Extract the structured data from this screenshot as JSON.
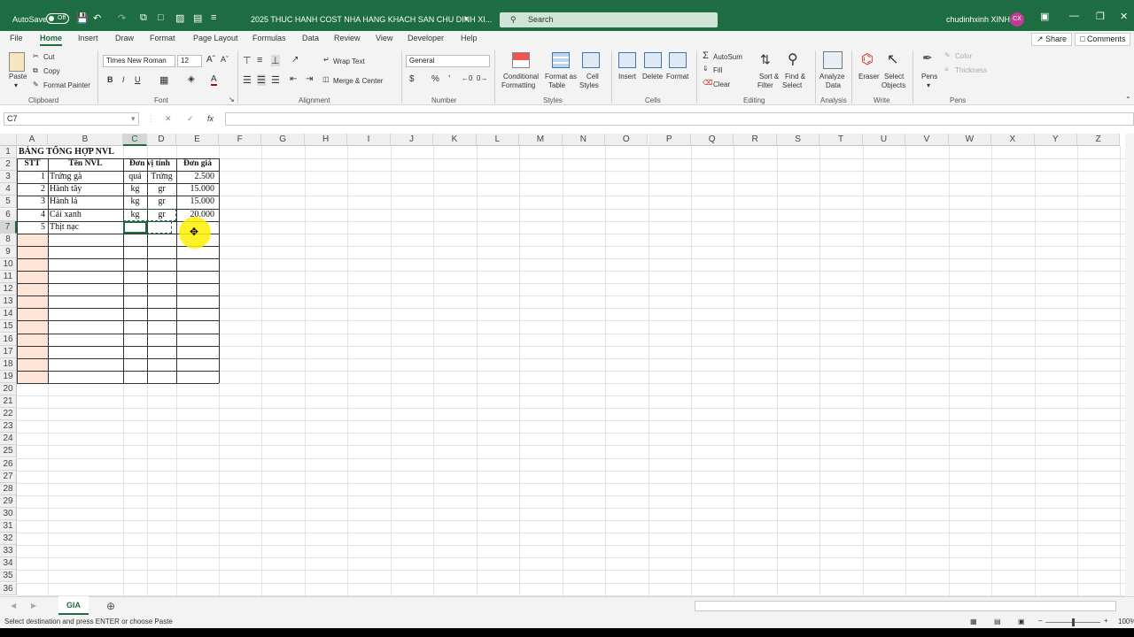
{
  "titlebar": {
    "autosave_label": "AutoSave",
    "autosave_state": "Off",
    "filename": "2025 THUC HANH COST NHA HANG KHACH SAN CHU DINH XI...",
    "search_placeholder": "Search",
    "user_name": "chudinhxinh XINH",
    "user_initials": "CX"
  },
  "menu": {
    "tabs": [
      "File",
      "Home",
      "Insert",
      "Draw",
      "Format",
      "Page Layout",
      "Formulas",
      "Data",
      "Review",
      "View",
      "Developer",
      "Help"
    ],
    "share_label": "Share",
    "comments_label": "Comments"
  },
  "ribbon": {
    "paste": "Paste",
    "cut": "Cut",
    "copy": "Copy",
    "format_painter": "Format Painter",
    "font_name": "Times New Roman",
    "font_size": "12",
    "wrap_text": "Wrap Text",
    "merge_center": "Merge & Center",
    "number_format": "General",
    "conditional_formatting_1": "Conditional",
    "conditional_formatting_2": "Formatting",
    "format_as_table_1": "Format as",
    "format_as_table_2": "Table",
    "cell_styles_1": "Cell",
    "cell_styles_2": "Styles",
    "insert": "Insert",
    "delete": "Delete",
    "format": "Format",
    "autosum": "AutoSum",
    "fill": "Fill",
    "clear": "Clear",
    "sort_filter_1": "Sort &",
    "sort_filter_2": "Filter",
    "find_select_1": "Find &",
    "find_select_2": "Select",
    "analyze_data_1": "Analyze",
    "analyze_data_2": "Data",
    "eraser": "Eraser",
    "select_objects_1": "Select",
    "select_objects_2": "Objects",
    "pens": "Pens",
    "color": "Color",
    "thickness": "Thickness",
    "groups": {
      "clipboard": "Clipboard",
      "font": "Font",
      "alignment": "Alignment",
      "number": "Number",
      "styles": "Styles",
      "cells": "Cells",
      "editing": "Editing",
      "analysis": "Analysis",
      "write": "Write",
      "pens": "Pens"
    }
  },
  "formula_bar": {
    "name_box": "C7",
    "fx": "fx",
    "content": ""
  },
  "columns": [
    "A",
    "B",
    "C",
    "D",
    "E",
    "F",
    "G",
    "H",
    "I",
    "J",
    "K",
    "L",
    "M",
    "N",
    "O",
    "P",
    "Q",
    "R",
    "S",
    "T",
    "U",
    "V",
    "W",
    "X",
    "Y",
    "Z"
  ],
  "rows": [
    "1",
    "2",
    "3",
    "4",
    "5",
    "6",
    "7",
    "8",
    "9",
    "10",
    "11",
    "12",
    "13",
    "14",
    "15",
    "16",
    "17",
    "18",
    "19",
    "20",
    "21",
    "22",
    "23",
    "24",
    "25",
    "26",
    "27",
    "28",
    "29",
    "30",
    "31",
    "32",
    "33",
    "34",
    "35",
    "36"
  ],
  "sheet": {
    "title": "BẢNG TỔNG HỢP NVL",
    "headers": [
      "STT",
      "Tên NVL",
      "Đơn vị tính",
      "Đơn giá"
    ],
    "rows": [
      {
        "stt": "1",
        "name": "Trứng gà",
        "unit": "quả",
        "unit2": "Trứng",
        "price": "2.500"
      },
      {
        "stt": "2",
        "name": "Hành tây",
        "unit": "kg",
        "unit2": "gr",
        "price": "15.000"
      },
      {
        "stt": "3",
        "name": "Hành lá",
        "unit": "kg",
        "unit2": "gr",
        "price": "15.000"
      },
      {
        "stt": "4",
        "name": "Cải xanh",
        "unit": "kg",
        "unit2": "gr",
        "price": "20.000"
      },
      {
        "stt": "5",
        "name": "Thịt nạc",
        "unit": "",
        "unit2": "",
        "price": ""
      }
    ]
  },
  "sheet_tab": "GIA",
  "status": "Select destination and press ENTER or choose Paste",
  "zoom": "100%"
}
